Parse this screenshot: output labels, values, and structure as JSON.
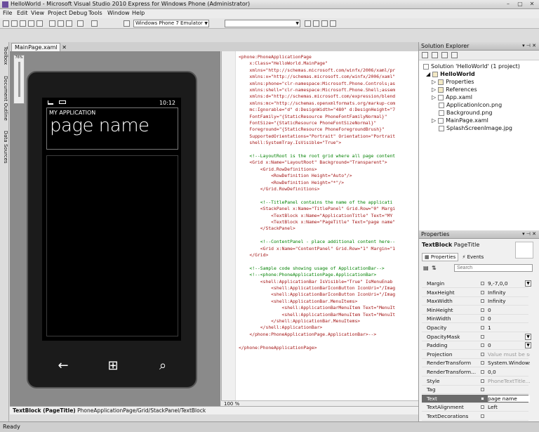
{
  "window": {
    "title": "HelloWorld - Microsoft Visual Studio 2010 Express for Windows Phone (Administrator)"
  },
  "menu": [
    "File",
    "Edit",
    "View",
    "Project",
    "Debug",
    "Tools",
    "Window",
    "Help"
  ],
  "toolbar": {
    "target": "Windows Phone 7 Emulator",
    "config": ""
  },
  "left_tabs": [
    "Toolbox",
    "Document Outline",
    "Data Sources"
  ],
  "tabs": {
    "document": "MainPage.xaml"
  },
  "designer": {
    "zoom": "76%",
    "time": "10:12",
    "app_title": "MY APPLICATION",
    "page_title": "page name"
  },
  "code": {
    "zoom": "100 %",
    "lines": [
      "<phone:PhoneApplicationPage",
      "    x:Class=\"HelloWorld.MainPage\"",
      "    xmlns=\"http://schemas.microsoft.com/winfx/2006/xaml/pr",
      "    xmlns:x=\"http://schemas.microsoft.com/winfx/2006/xaml\"",
      "    xmlns:phone=\"clr-namespace:Microsoft.Phone.Controls;as",
      "    xmlns:shell=\"clr-namespace:Microsoft.Phone.Shell;assem",
      "    xmlns:d=\"http://schemas.microsoft.com/expression/blend",
      "    xmlns:mc=\"http://schemas.openxmlformats.org/markup-com",
      "    mc:Ignorable=\"d\" d:DesignWidth=\"480\" d:DesignHeight=\"7",
      "    FontFamily=\"{StaticResource PhoneFontFamilyNormal}\"",
      "    FontSize=\"{StaticResource PhoneFontSizeNormal}\"",
      "    Foreground=\"{StaticResource PhoneForegroundBrush}\"",
      "    SupportedOrientations=\"Portrait\" Orientation=\"Portrait",
      "    shell:SystemTray.IsVisible=\"True\">",
      "",
      "    <!--LayoutRoot is the root grid where all page content",
      "    <Grid x:Name=\"LayoutRoot\" Background=\"Transparent\">",
      "        <Grid.RowDefinitions>",
      "            <RowDefinition Height=\"Auto\"/>",
      "            <RowDefinition Height=\"*\"/>",
      "        </Grid.RowDefinitions>",
      "",
      "        <!--TitlePanel contains the name of the applicati",
      "        <StackPanel x:Name=\"TitlePanel\" Grid.Row=\"0\" Margi",
      "            <TextBlock x:Name=\"ApplicationTitle\" Text=\"MY",
      "            <TextBlock x:Name=\"PageTitle\" Text=\"page name\"",
      "        </StackPanel>",
      "",
      "        <!--ContentPanel - place additional content here--",
      "        <Grid x:Name=\"ContentPanel\" Grid.Row=\"1\" Margin=\"1",
      "    </Grid>",
      "",
      "    <!--Sample code showing usage of ApplicationBar-->",
      "    <!--<phone:PhoneApplicationPage.ApplicationBar>",
      "        <shell:ApplicationBar IsVisible=\"True\" IsMenuEnab",
      "            <shell:ApplicationBarIconButton IconUri=\"/Imag",
      "            <shell:ApplicationBarIconButton IconUri=\"/Imag",
      "            <shell:ApplicationBar.MenuItems>",
      "                <shell:ApplicationBarMenuItem Text=\"MenuIt",
      "                <shell:ApplicationBarMenuItem Text=\"MenuIt",
      "            </shell:ApplicationBar.MenuItems>",
      "        </shell:ApplicationBar>",
      "    </phone:PhoneApplicationPage.ApplicationBar>-->",
      "",
      "</phone:PhoneApplicationPage>"
    ]
  },
  "solution_explorer": {
    "title": "Solution Explorer",
    "items": [
      "Solution 'HelloWorld' (1 project)",
      "HelloWorld",
      "Properties",
      "References",
      "App.xaml",
      "ApplicationIcon.png",
      "Background.png",
      "MainPage.xaml",
      "SplashScreenImage.jpg"
    ]
  },
  "properties": {
    "title": "Properties",
    "selected_type": "TextBlock",
    "selected_name": "PageTitle",
    "tab_properties": "Properties",
    "tab_events": "Events",
    "search_placeholder": "Search",
    "rows": [
      {
        "name": "Margin",
        "value": "9,-7,0,0"
      },
      {
        "name": "MaxHeight",
        "value": "Infinity"
      },
      {
        "name": "MaxWidth",
        "value": "Infinity"
      },
      {
        "name": "MinHeight",
        "value": "0"
      },
      {
        "name": "MinWidth",
        "value": "0"
      },
      {
        "name": "Opacity",
        "value": "1"
      },
      {
        "name": "OpacityMask",
        "value": ""
      },
      {
        "name": "Padding",
        "value": "0"
      },
      {
        "name": "Projection",
        "value": "Value must be set"
      },
      {
        "name": "RenderTransform",
        "value": "System.Windows"
      },
      {
        "name": "RenderTransform...",
        "value": "0,0"
      },
      {
        "name": "Style",
        "value": "PhoneTextTitle..."
      },
      {
        "name": "Tag",
        "value": ""
      },
      {
        "name": "Text",
        "value": "page name"
      },
      {
        "name": "TextAlignment",
        "value": "Left"
      },
      {
        "name": "TextDecorations",
        "value": ""
      }
    ]
  },
  "status": {
    "element": "TextBlock (PageTitle)",
    "path": "PhoneApplicationPage/Grid/StackPanel/TextBlock"
  },
  "bottom": {
    "text": "Ready"
  }
}
